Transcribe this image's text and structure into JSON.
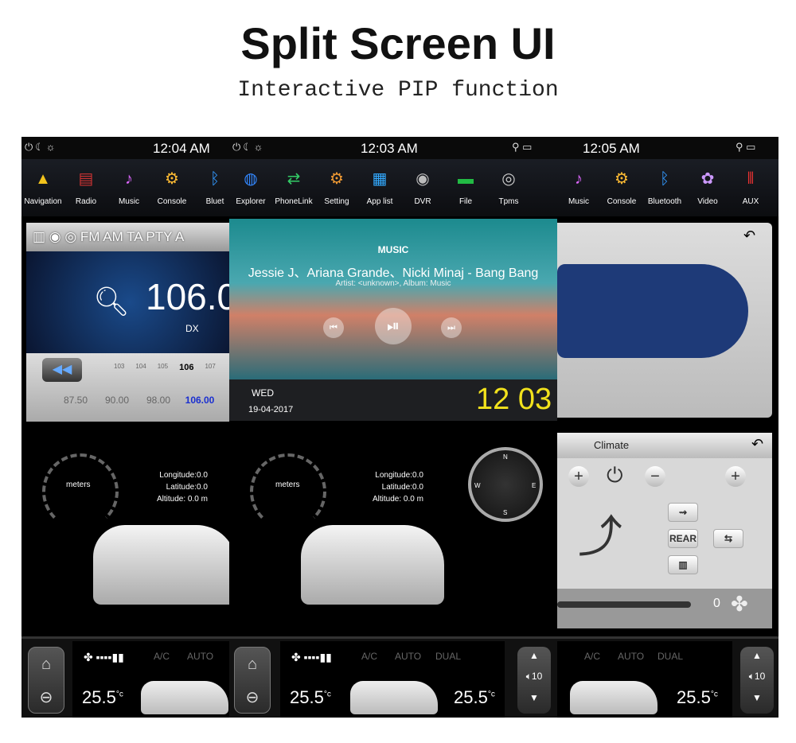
{
  "title": "Split Screen UI",
  "subtitle": "Interactive PIP function",
  "panels": [
    {
      "time": "12:04 AM",
      "apps": [
        {
          "label": "Navigation",
          "icon": "navigation-icon"
        },
        {
          "label": "Radio",
          "icon": "radio-icon"
        },
        {
          "label": "Music",
          "icon": "music-icon"
        },
        {
          "label": "Console",
          "icon": "console-icon"
        },
        {
          "label": "Bluet",
          "icon": "bluetooth-icon"
        }
      ]
    },
    {
      "time": "12:03 AM",
      "apps": [
        {
          "label": "Explorer",
          "icon": "globe-icon"
        },
        {
          "label": "PhoneLink",
          "icon": "phonelink-icon"
        },
        {
          "label": "Setting",
          "icon": "gear-icon"
        },
        {
          "label": "App list",
          "icon": "grid-icon"
        },
        {
          "label": "DVR",
          "icon": "camera-icon"
        },
        {
          "label": "File",
          "icon": "folder-icon"
        },
        {
          "label": "Tpms",
          "icon": "tire-icon"
        }
      ]
    },
    {
      "time": "12:05 AM",
      "apps": [
        {
          "label": "Music",
          "icon": "music-icon"
        },
        {
          "label": "Console",
          "icon": "console-icon"
        },
        {
          "label": "Bluetooth",
          "icon": "bluetooth-icon"
        },
        {
          "label": "Video",
          "icon": "video-icon"
        },
        {
          "label": "AUX",
          "icon": "aux-icon"
        }
      ]
    }
  ],
  "radio": {
    "bands": "FM  AM  TA  PTY  A",
    "frequency": "106.0",
    "mode": "DX",
    "scale": [
      "103",
      "104",
      "105",
      "106",
      "107"
    ],
    "presets": [
      "87.50",
      "90.00",
      "98.00",
      "106.00"
    ],
    "active_preset": "106.00"
  },
  "music": {
    "header": "MUSIC",
    "track": "Jessie J、Ariana Grande、Nicki Minaj - Bang Bang",
    "meta": "Artist: <unknown>, Album: Music",
    "day": "WED",
    "date": "19-04-2017",
    "clock": "12 03"
  },
  "gps": {
    "gauge_label": "meters",
    "longitude": "Longitude:0.0",
    "latitude": "Latitude:0.0",
    "altitude": "Altitude:  0.0 m",
    "compass": [
      "N",
      "E",
      "S",
      "W"
    ]
  },
  "climate_panel": {
    "title": "Climate",
    "rear": "REAR",
    "fan_value": "0"
  },
  "bottom": {
    "ac": "A/C",
    "auto": "AUTO",
    "dual": "DUAL",
    "temp": "25.5",
    "unit": "°c",
    "volume": "10"
  },
  "colors": {
    "accent_yellow": "#f2e21c",
    "preset_active": "#1a2fd0"
  }
}
